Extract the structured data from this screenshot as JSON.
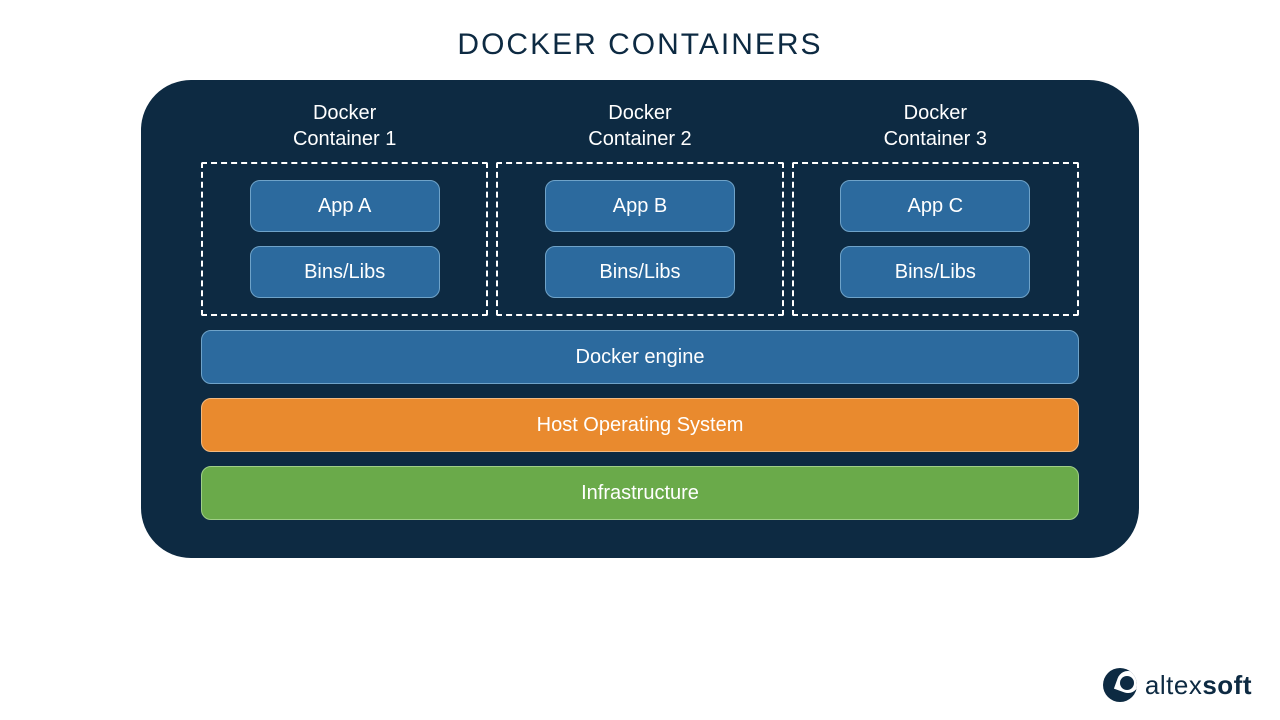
{
  "title": "DOCKER CONTAINERS",
  "containers": [
    {
      "label": "Docker\nContainer 1",
      "app": "App A",
      "bins": "Bins/Libs"
    },
    {
      "label": "Docker\nContainer 2",
      "app": "App B",
      "bins": "Bins/Libs"
    },
    {
      "label": "Docker\nContainer 3",
      "app": "App C",
      "bins": "Bins/Libs"
    }
  ],
  "layers": {
    "engine": "Docker engine",
    "host": "Host Operating System",
    "infra": "Infrastructure"
  },
  "brand": {
    "name_light": "altex",
    "name_bold": "soft"
  },
  "colors": {
    "panel": "#0d2a42",
    "blue": "#2c6a9e",
    "orange": "#e98a2e",
    "green": "#6aaa4a"
  }
}
